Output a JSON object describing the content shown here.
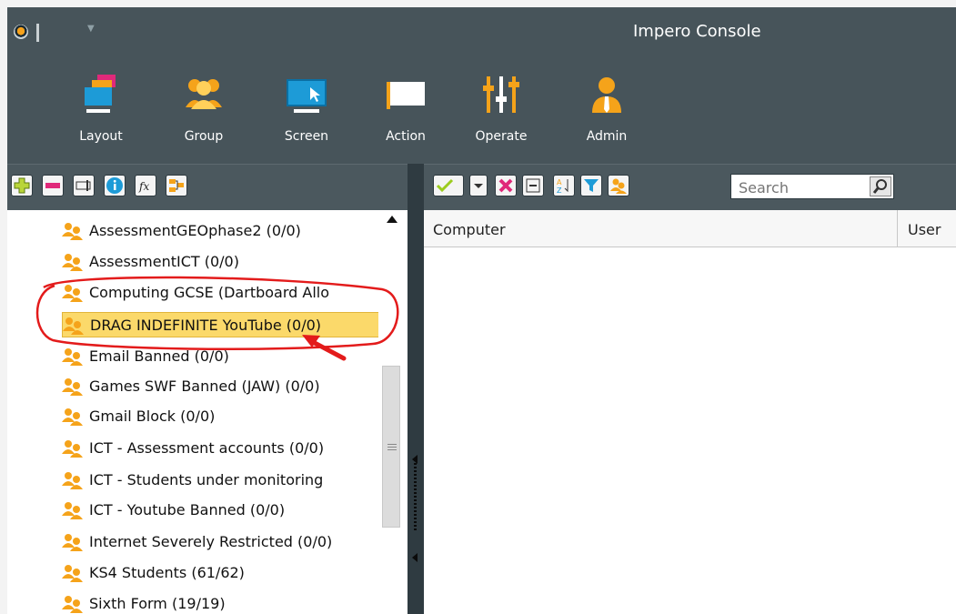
{
  "window": {
    "title": "Impero Console"
  },
  "ribbon": [
    {
      "label": "Layout"
    },
    {
      "label": "Group"
    },
    {
      "label": "Screen"
    },
    {
      "label": "Action"
    },
    {
      "label": "Operate"
    },
    {
      "label": "Admin"
    }
  ],
  "left_toolbar": {
    "icons": [
      "add-icon",
      "remove-icon",
      "rename-icon",
      "info-icon",
      "function-icon",
      "group-settings-icon"
    ]
  },
  "right_toolbar": {
    "icons": [
      "check-icon",
      "dropdown-icon",
      "delete-icon",
      "collapse-icon",
      "sort-icon",
      "filter-icon",
      "group-icon"
    ],
    "search_placeholder": "Search"
  },
  "groups": [
    {
      "label": "AssessmentGEOphase2 (0/0)"
    },
    {
      "label": "AssessmentICT (0/0)"
    },
    {
      "label": "Computing GCSE (Dartboard Allo"
    },
    {
      "label": "DRAG INDEFINITE YouTube (0/0)"
    },
    {
      "label": "Email Banned (0/0)"
    },
    {
      "label": "Games SWF Banned (JAW) (0/0)"
    },
    {
      "label": "Gmail Block (0/0)"
    },
    {
      "label": "ICT - Assessment accounts (0/0)"
    },
    {
      "label": "ICT - Students under monitoring"
    },
    {
      "label": "ICT - Youtube Banned (0/0)"
    },
    {
      "label": "Internet Severely Restricted (0/0)"
    },
    {
      "label": "KS4 Students (61/62)"
    },
    {
      "label": "Sixth Form (19/19)"
    }
  ],
  "grid": {
    "columns": [
      "Computer",
      "User"
    ]
  },
  "colors": {
    "accent_orange": "#f5a31a",
    "selected": "#fbd96a",
    "annotation": "#e31b1b"
  }
}
